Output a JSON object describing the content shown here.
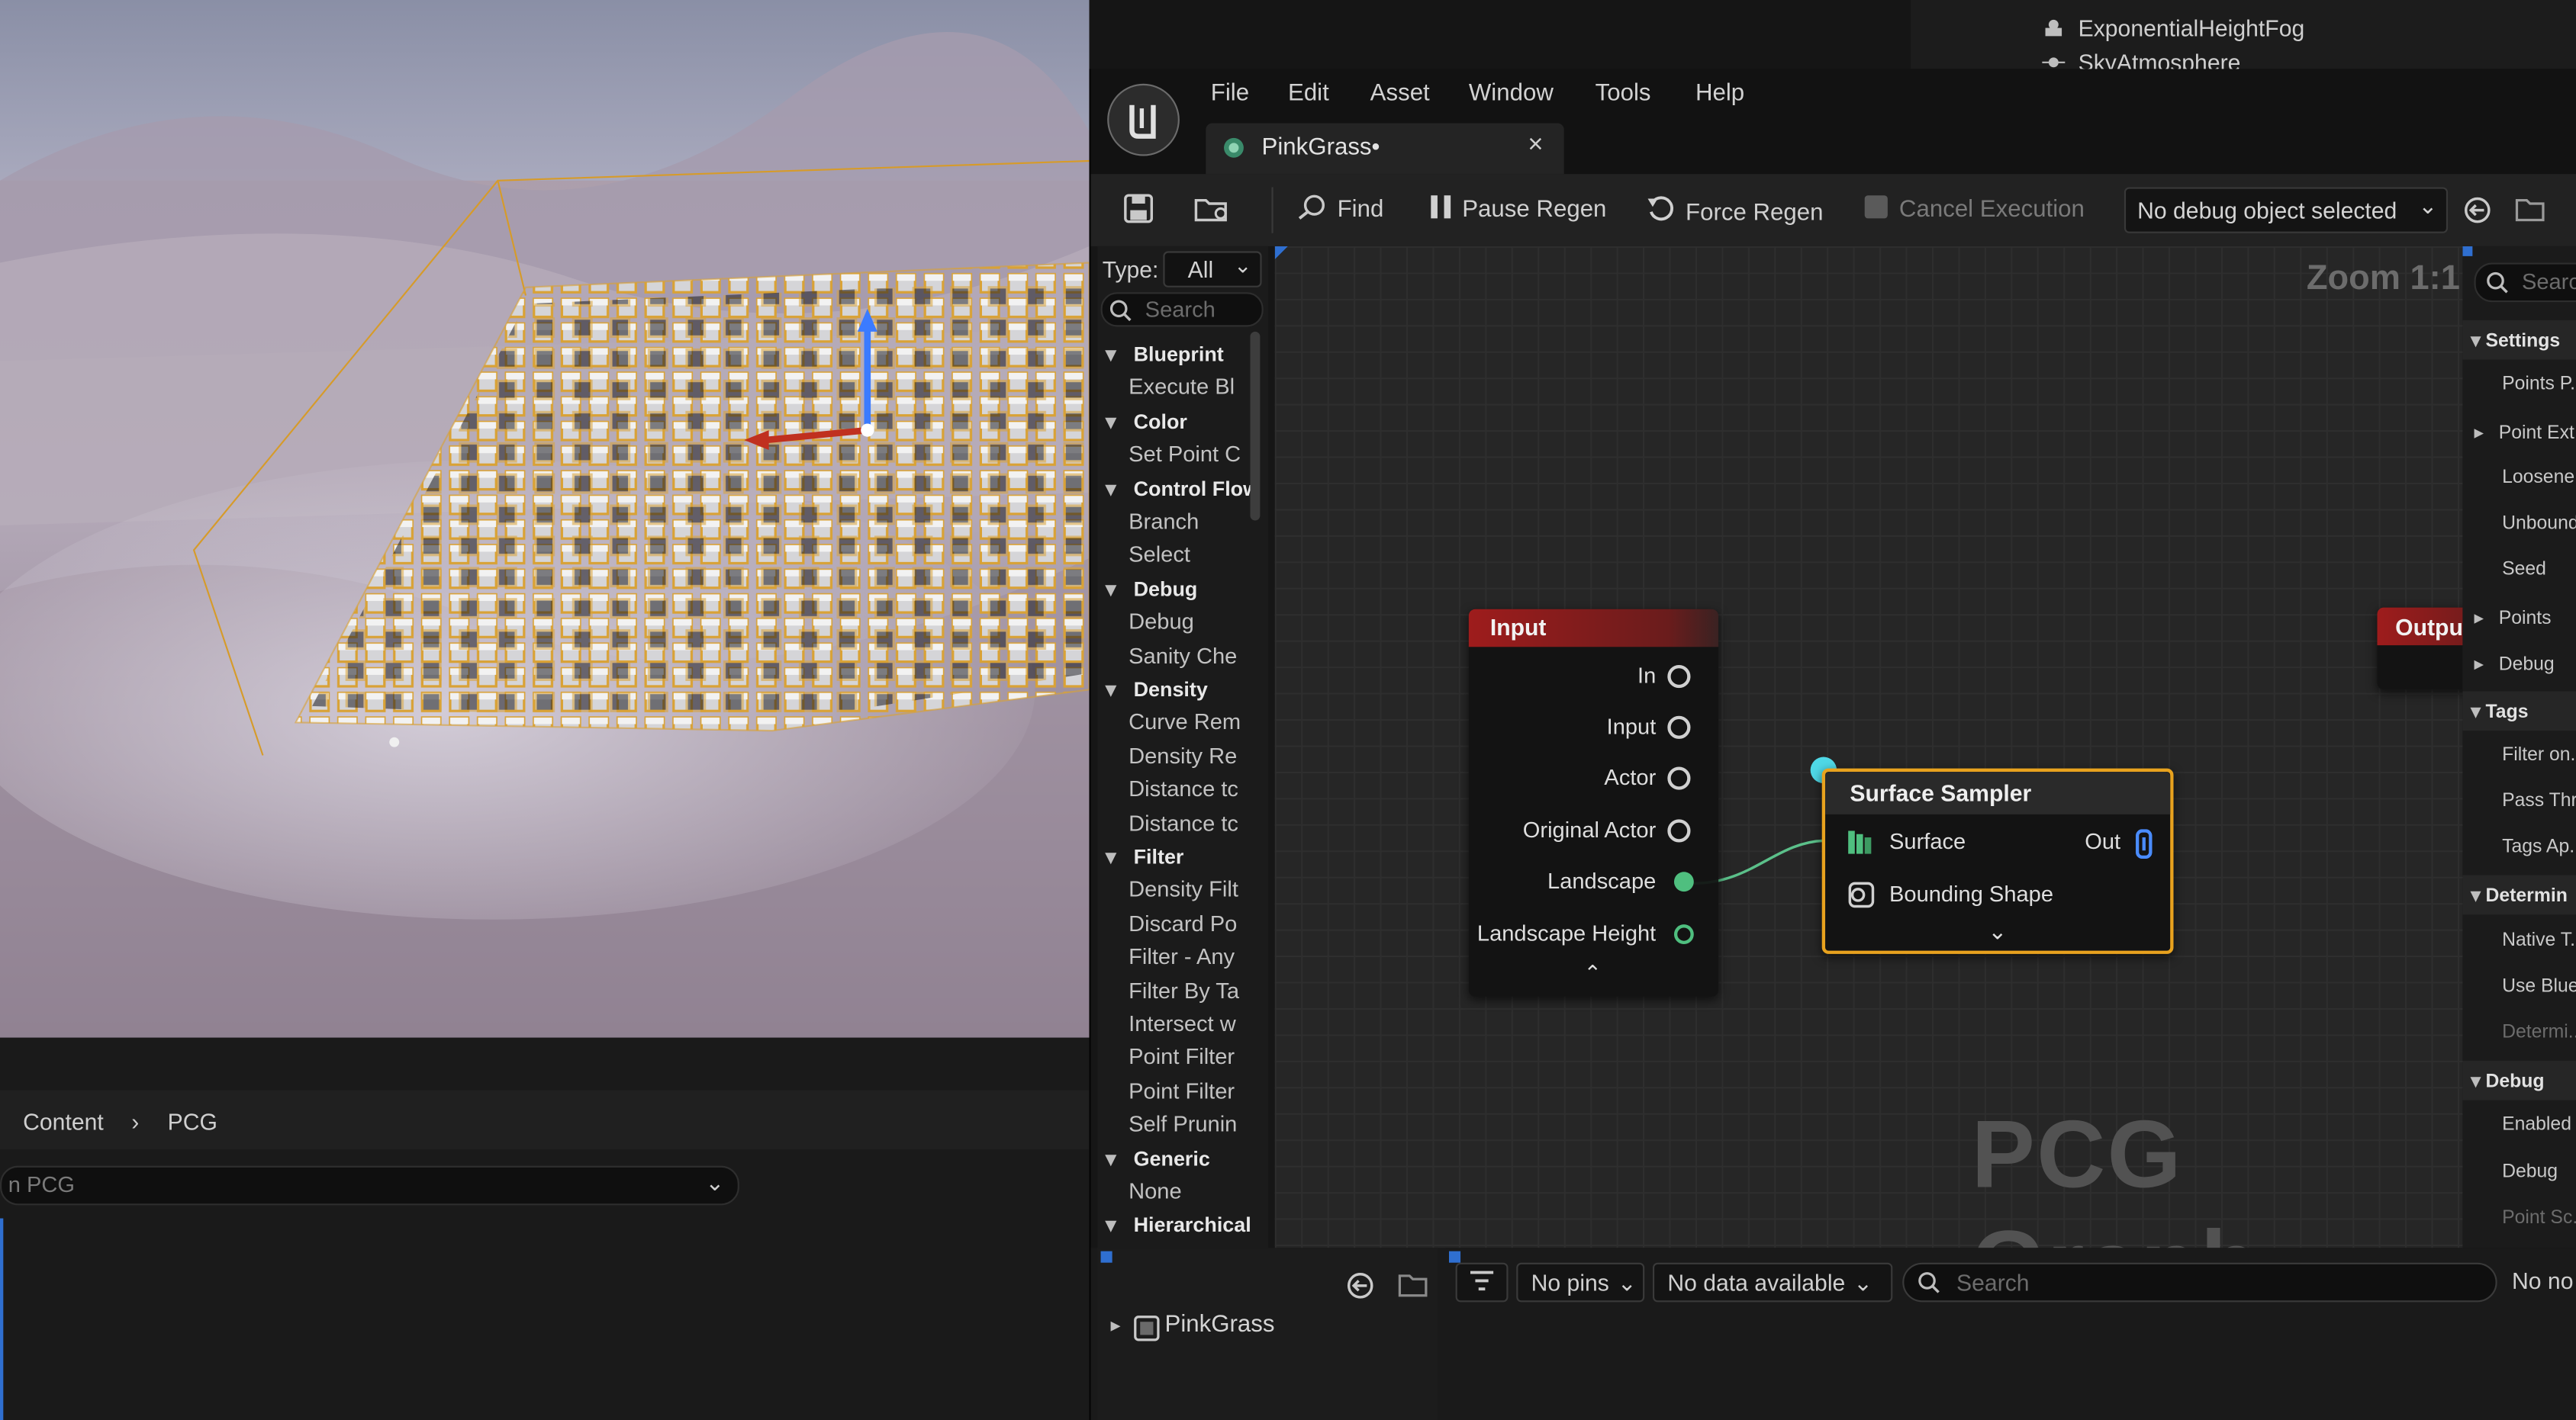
{
  "outliner": {
    "items": [
      "ExponentialHeightFog",
      "SkyAtmosphere"
    ]
  },
  "content_browser": {
    "breadcrumb": [
      "Content",
      "PCG"
    ],
    "search_placeholder": "n PCG"
  },
  "editor": {
    "menu": [
      "File",
      "Edit",
      "Asset",
      "Window",
      "Tools",
      "Help"
    ],
    "tab_title": "PinkGrass•",
    "toolbar": {
      "find": "Find",
      "pause_regen": "Pause Regen",
      "force_regen": "Force Regen",
      "cancel_execution": "Cancel Execution",
      "debug_object": "No debug object selected"
    },
    "palette": {
      "type_label": "Type:",
      "type_value": "All",
      "search_placeholder": "Search",
      "rows": [
        {
          "kind": "cat",
          "label": "Blueprint"
        },
        {
          "kind": "item",
          "label": "Execute Bl"
        },
        {
          "kind": "cat",
          "label": "Color"
        },
        {
          "kind": "item",
          "label": "Set Point C"
        },
        {
          "kind": "cat",
          "label": "Control Flow"
        },
        {
          "kind": "item",
          "label": "Branch"
        },
        {
          "kind": "item",
          "label": "Select"
        },
        {
          "kind": "cat",
          "label": "Debug"
        },
        {
          "kind": "item",
          "label": "Debug"
        },
        {
          "kind": "item",
          "label": "Sanity Che"
        },
        {
          "kind": "cat",
          "label": "Density"
        },
        {
          "kind": "item",
          "label": "Curve Rem"
        },
        {
          "kind": "item",
          "label": "Density Re"
        },
        {
          "kind": "item",
          "label": "Distance tc"
        },
        {
          "kind": "item",
          "label": "Distance tc"
        },
        {
          "kind": "cat",
          "label": "Filter"
        },
        {
          "kind": "item",
          "label": "Density Filt"
        },
        {
          "kind": "item",
          "label": "Discard Po"
        },
        {
          "kind": "item",
          "label": "Filter - Any"
        },
        {
          "kind": "item",
          "label": "Filter By Ta"
        },
        {
          "kind": "item",
          "label": "Intersect w"
        },
        {
          "kind": "item",
          "label": "Point Filter"
        },
        {
          "kind": "item",
          "label": "Point Filter"
        },
        {
          "kind": "item",
          "label": "Self Prunin"
        },
        {
          "kind": "cat",
          "label": "Generic"
        },
        {
          "kind": "item",
          "label": "None"
        },
        {
          "kind": "cat",
          "label": "Hierarchical"
        }
      ]
    },
    "graph": {
      "zoom": "Zoom 1:1",
      "watermark": "PCG Graph",
      "input_node": {
        "title": "Input",
        "pins": [
          "In",
          "Input",
          "Actor",
          "Original Actor",
          "Landscape",
          "Landscape Height"
        ]
      },
      "sampler_node": {
        "title": "Surface Sampler",
        "in_pins": [
          "Surface",
          "Bounding Shape"
        ],
        "out_pin": "Out"
      },
      "output_node": {
        "title": "Outpu"
      }
    },
    "details": {
      "search_placeholder": "Searc",
      "rows": [
        {
          "kind": "cat",
          "label": "Settings"
        },
        {
          "kind": "item",
          "label": "Points P..."
        },
        {
          "kind": "expand",
          "label": "Point Ext..."
        },
        {
          "kind": "item",
          "label": "Loosene..."
        },
        {
          "kind": "item",
          "label": "Unbound..."
        },
        {
          "kind": "item",
          "label": "Seed"
        },
        {
          "kind": "expand",
          "label": "Points"
        },
        {
          "kind": "expand",
          "label": "Debug"
        },
        {
          "kind": "cat",
          "label": "Tags"
        },
        {
          "kind": "item",
          "label": "Filter on..."
        },
        {
          "kind": "item",
          "label": "Pass Thr..."
        },
        {
          "kind": "item",
          "label": "Tags Ap..."
        },
        {
          "kind": "cat",
          "label": "Determin"
        },
        {
          "kind": "item",
          "label": "Native T..."
        },
        {
          "kind": "item",
          "label": "Use Blue..."
        },
        {
          "kind": "dim",
          "label": "Determi..."
        },
        {
          "kind": "cat",
          "label": "Debug"
        },
        {
          "kind": "item",
          "label": "Enabled"
        },
        {
          "kind": "item",
          "label": "Debug"
        },
        {
          "kind": "dim",
          "label": "Point Sc..."
        }
      ]
    },
    "bottom": {
      "tree_item": "PinkGrass",
      "pins_filter": "No pins",
      "data_filter": "No data available",
      "search_placeholder": "Search",
      "status": "No no"
    }
  }
}
